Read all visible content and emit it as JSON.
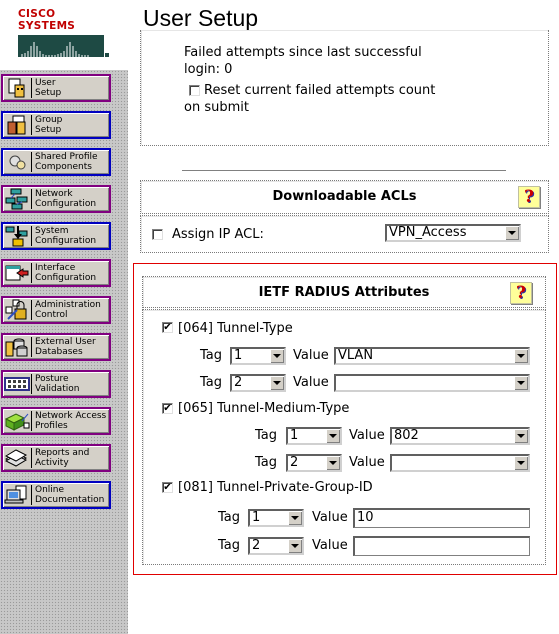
{
  "header": {
    "logo_text": "Cisco Systems",
    "page_title": "User Setup"
  },
  "sidebar": {
    "items": [
      {
        "label": "User\nSetup",
        "icon": "user-setup-icon",
        "border": "purple"
      },
      {
        "label": "Group\nSetup",
        "icon": "group-setup-icon",
        "border": "blue"
      },
      {
        "label": "Shared Profile\nComponents",
        "icon": "shared-profile-icon",
        "border": "blue"
      },
      {
        "label": "Network\nConfiguration",
        "icon": "network-configuration-icon",
        "border": "purple"
      },
      {
        "label": "System\nConfiguration",
        "icon": "system-configuration-icon",
        "border": "blue"
      },
      {
        "label": "Interface\nConfiguration",
        "icon": "interface-configuration-icon",
        "border": "purple"
      },
      {
        "label": "Administration\nControl",
        "icon": "administration-control-icon",
        "border": "purple"
      },
      {
        "label": "External User\nDatabases",
        "icon": "external-user-databases-icon",
        "border": "purple"
      },
      {
        "label": "Posture\nValidation",
        "icon": "posture-validation-icon",
        "border": "purple"
      },
      {
        "label": "Network Access\nProfiles",
        "icon": "network-access-profiles-icon",
        "border": "purple"
      },
      {
        "label": "Reports and\nActivity",
        "icon": "reports-activity-icon",
        "border": "purple"
      },
      {
        "label": "Online\nDocumentation",
        "icon": "online-documentation-icon",
        "border": "blue"
      }
    ]
  },
  "account_status": {
    "failed_attempts_line1": "Failed attempts since last successful",
    "failed_attempts_line2": "login: 0",
    "reset_label_line1": "Reset current failed attempts count",
    "reset_label_line2": "on submit",
    "reset_checked": false
  },
  "downloadable_acls": {
    "title": "Downloadable ACLs",
    "assign_label": "Assign IP ACL:",
    "assign_checked": false,
    "acl_selected": "VPN_Access"
  },
  "ietf_radius": {
    "title": "IETF RADIUS Attributes",
    "attributes": [
      {
        "label": "[064] Tunnel-Type",
        "checked": true,
        "rows": [
          {
            "tag_label": "Tag",
            "tag": "1",
            "value_label": "Value",
            "value": "VLAN"
          },
          {
            "tag_label": "Tag",
            "tag": "2",
            "value_label": "Value",
            "value": ""
          }
        ]
      },
      {
        "label": "[065] Tunnel-Medium-Type",
        "checked": true,
        "rows": [
          {
            "tag_label": "Tag",
            "tag": "1",
            "value_label": "Value",
            "value": "802"
          },
          {
            "tag_label": "Tag",
            "tag": "2",
            "value_label": "Value",
            "value": ""
          }
        ]
      },
      {
        "label": "[081] Tunnel-Private-Group-ID",
        "checked": true,
        "rows": [
          {
            "tag_label": "Tag",
            "tag": "1",
            "value_label": "Value",
            "value": "10"
          },
          {
            "tag_label": "Tag",
            "tag": "2",
            "value_label": "Value",
            "value": ""
          }
        ]
      }
    ]
  },
  "colors": {
    "highlight_frame": "#e00000",
    "nav_border_purple": "#800080",
    "nav_border_blue": "#0000c0",
    "logo_red": "#c00000",
    "logo_green": "#1e4a44"
  },
  "glyphs": {
    "check": "✔",
    "help": "?"
  }
}
